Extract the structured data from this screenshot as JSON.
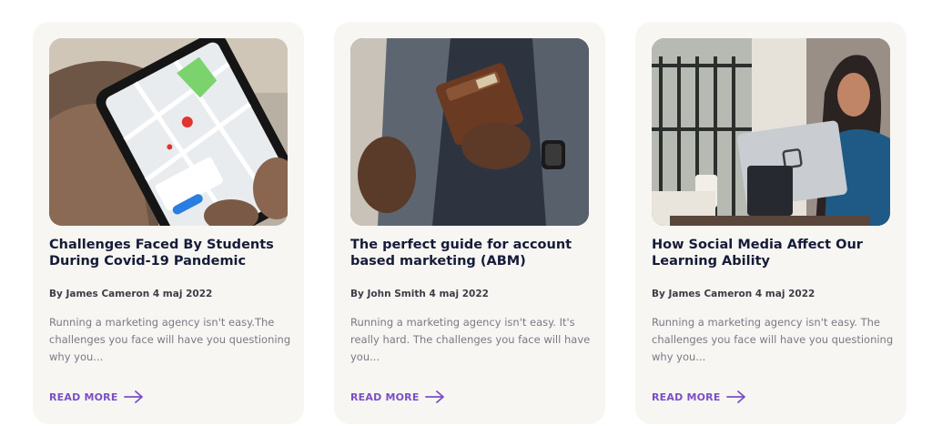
{
  "posts": [
    {
      "title": "Challenges Faced By Students During Covid-19 Pandemic",
      "author_date": "By James Cameron 4 maj 2022",
      "excerpt": "Running a marketing agency isn't easy.The challenges you face will have you questioning why you...",
      "read_more": "READ MORE",
      "image_icon": "phone-map-image"
    },
    {
      "title": "The perfect guide for account based marketing (ABM)",
      "author_date": "By John Smith 4 maj 2022",
      "excerpt": "Running a marketing agency isn't easy. It's really hard. The challenges you face will have you...",
      "read_more": "READ MORE",
      "image_icon": "wallet-jacket-image"
    },
    {
      "title": "How Social Media Affect Our Learning Ability",
      "author_date": "By James Cameron 4 maj 2022",
      "excerpt": "Running a marketing agency isn't easy. The challenges you face will have you questioning why you...",
      "read_more": "READ MORE",
      "image_icon": "laptop-cafe-image"
    }
  ],
  "colors": {
    "card_bg": "#f8f6f3",
    "title": "#141c38",
    "meta": "#3d3d46",
    "excerpt": "#797985",
    "accent": "#7b4fc4"
  }
}
